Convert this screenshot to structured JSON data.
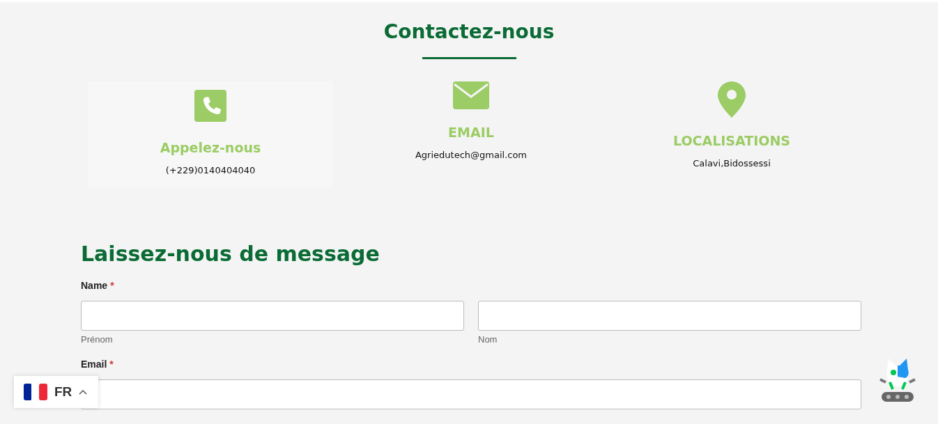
{
  "title": "Contactez-nous",
  "contacts": [
    {
      "kind": "phone",
      "heading": "Appelez-nous",
      "text": "(+229)0140404040",
      "highlighted": true
    },
    {
      "kind": "email",
      "heading": "EMAIL",
      "text": "Agriedutech@gmail.com",
      "highlighted": false
    },
    {
      "kind": "location",
      "heading": "LOCALISATIONS",
      "text": "Calavi,Bidossessi",
      "highlighted": false
    }
  ],
  "form": {
    "title": "Laissez-nous de message",
    "fields": [
      {
        "label": "Name",
        "required": "*",
        "sublabels": [
          "Prénom",
          "Nom"
        ]
      },
      {
        "label": "Email",
        "required": "*"
      }
    ]
  },
  "language": {
    "code": "FR"
  }
}
